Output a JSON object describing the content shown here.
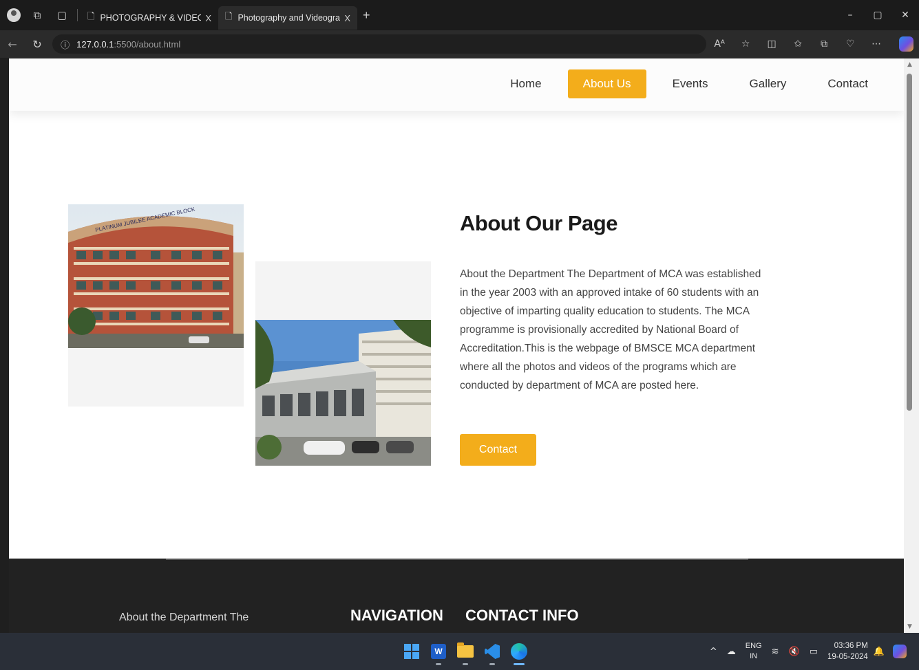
{
  "browser": {
    "tabs": [
      {
        "label": "PHOTOGRAPHY & VIDEOGRAPH",
        "close": "X"
      },
      {
        "label": "Photography and Videography V",
        "close": "X"
      }
    ],
    "new_tab": "+",
    "url_host": "127.0.0.1",
    "url_path": ":5500/about.html"
  },
  "site": {
    "nav": [
      "Home",
      "About Us",
      "Events",
      "Gallery",
      "Contact"
    ],
    "active_nav": "About Us",
    "about_title": "About Our Page",
    "about_text": "About the Department The Department of MCA was established in the year 2003 with an approved intake of 60 students with an objective of imparting quality education to students. The MCA programme is provisionally accredited by National Board of Accreditation.This is the webpage of BMSCE MCA department where all the photos and videos of the programs which are conducted by department of MCA are posted here.",
    "contact_button": "Contact",
    "building_sign": "PLATINUM JUBILEE ACADEMIC BLOCK",
    "footer": {
      "about_snippet": "About the Department The",
      "heading_navigation": "NAVIGATION",
      "heading_contact": "CONTACT INFO"
    }
  },
  "taskbar": {
    "lang_top": "ENG",
    "lang_bottom": "IN",
    "time": "03:36 PM",
    "date": "19-05-2024"
  },
  "colors": {
    "accent": "#f3ad1b",
    "footer_bg": "#222222",
    "browser_chrome": "#2b2b2b"
  }
}
